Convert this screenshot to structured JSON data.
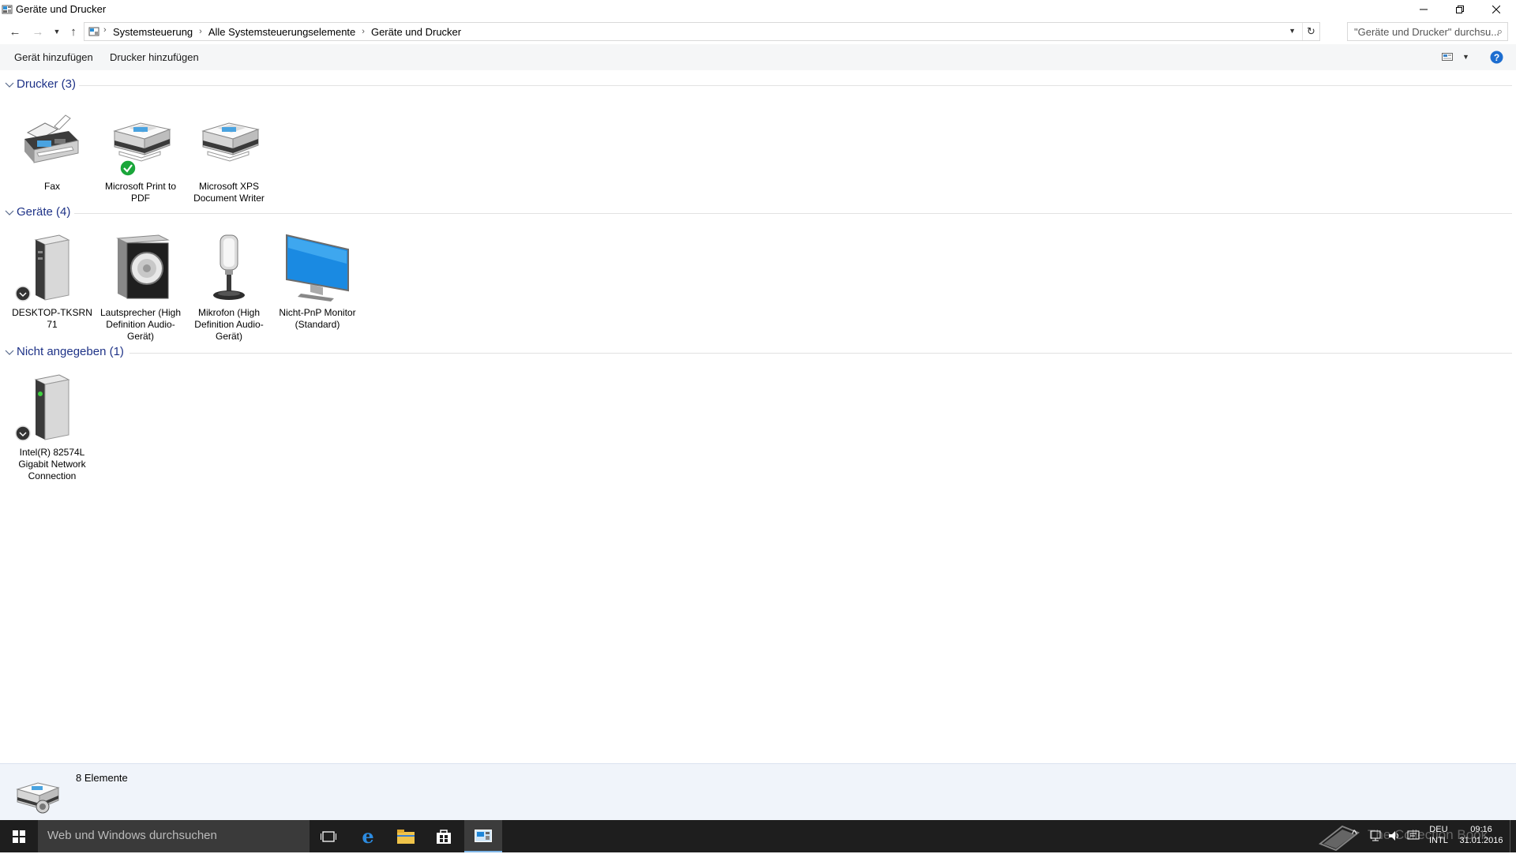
{
  "window": {
    "title": "Geräte und Drucker",
    "minimize_icon": "minimize-icon",
    "restore_icon": "restore-icon",
    "close_icon": "close-icon"
  },
  "address": {
    "crumbs": [
      "Systemsteuerung",
      "Alle Systemsteuerungselemente",
      "Geräte und Drucker"
    ],
    "search_placeholder": "\"Geräte und Drucker\" durchsu..."
  },
  "commands": {
    "add_device": "Gerät hinzufügen",
    "add_printer": "Drucker hinzufügen"
  },
  "groups": [
    {
      "title": "Drucker (3)",
      "items": [
        {
          "label": "Fax",
          "icon": "fax-icon"
        },
        {
          "label": "Microsoft Print to PDF",
          "icon": "printer-icon",
          "badge": "default-checkmark-icon"
        },
        {
          "label": "Microsoft XPS Document Writer",
          "icon": "printer-icon"
        }
      ]
    },
    {
      "title": "Geräte (4)",
      "items": [
        {
          "label": "DESKTOP-TKSRN 71",
          "icon": "computer-tower-icon"
        },
        {
          "label": "Lautsprecher (High Definition Audio-Gerät)",
          "icon": "speaker-icon"
        },
        {
          "label": "Mikrofon (High Definition Audio-Gerät)",
          "icon": "microphone-icon"
        },
        {
          "label": "Nicht-PnP Monitor (Standard)",
          "icon": "monitor-icon"
        }
      ]
    },
    {
      "title": "Nicht angegeben (1)",
      "items": [
        {
          "label": "Intel(R) 82574L Gigabit Network Connection",
          "icon": "network-device-icon"
        }
      ]
    }
  ],
  "details": {
    "count": "8 Elemente"
  },
  "taskbar": {
    "search_placeholder": "Web und Windows durchsuchen",
    "watermark": "The Collection Book",
    "lang_top": "DEU",
    "lang_bottom": "INTL",
    "time": "09:16",
    "date": "31.01.2016"
  },
  "colors": {
    "group_title": "#1e3287",
    "taskbar": "#1e1e1e",
    "help": "#1c6dd0",
    "check": "#1aa63a"
  }
}
